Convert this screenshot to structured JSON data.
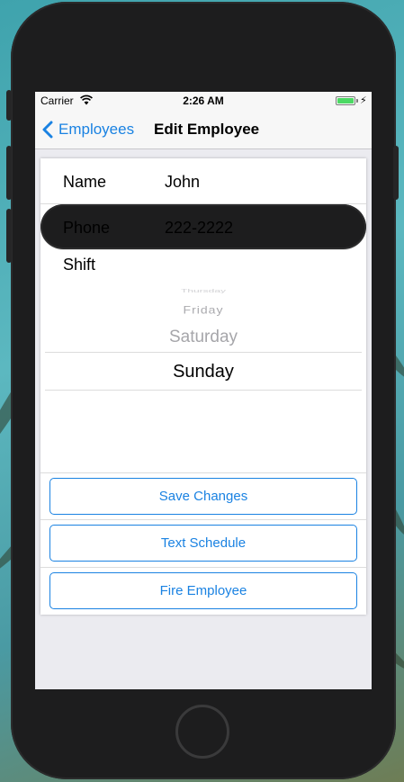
{
  "status_bar": {
    "carrier": "Carrier",
    "time": "2:26 AM",
    "wifi_icon": "wifi-icon",
    "battery_icon": "battery-icon",
    "charging_icon": "bolt-icon"
  },
  "nav": {
    "back_label": "Employees",
    "back_icon": "chevron-left-icon",
    "title": "Edit Employee"
  },
  "form": {
    "name_label": "Name",
    "name_value": "John",
    "phone_label": "Phone",
    "phone_value": "222-2222",
    "shift_label": "Shift"
  },
  "picker": {
    "items": [
      "Thursday",
      "Friday",
      "Saturday",
      "Sunday"
    ],
    "selected": "Sunday"
  },
  "buttons": {
    "save": "Save Changes",
    "text_schedule": "Text Schedule",
    "fire": "Fire Employee"
  },
  "colors": {
    "accent": "#1a82e2",
    "battery": "#4cd964"
  }
}
